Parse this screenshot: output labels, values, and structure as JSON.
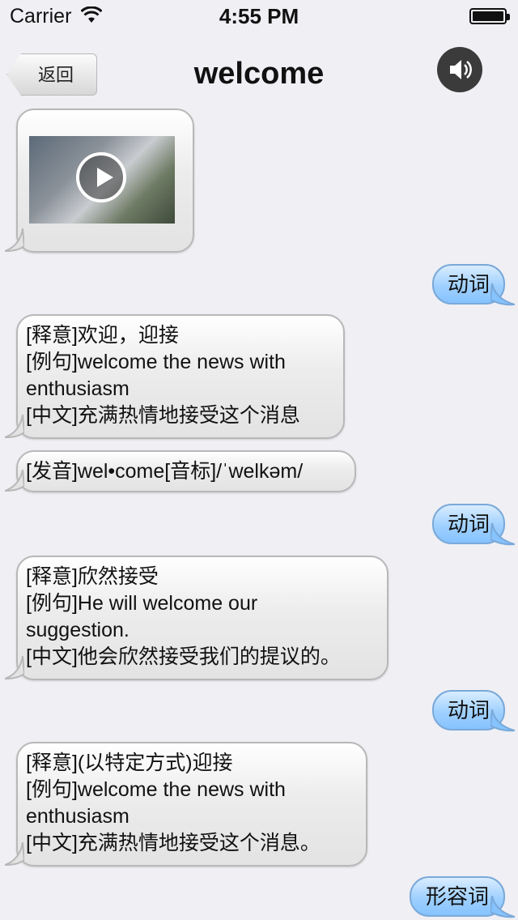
{
  "status_bar": {
    "carrier": "Carrier",
    "time": "4:55 PM"
  },
  "nav": {
    "back_label": "返回",
    "title": "welcome",
    "speaker_icon": "speaker-icon"
  },
  "messages": [
    {
      "type": "video",
      "icon": "play-icon"
    },
    {
      "side": "right",
      "text": "动词"
    },
    {
      "side": "left",
      "lines": [
        "[释意]欢迎，迎接",
        "[例句]welcome the news with",
        "enthusiasm",
        "[中文]充满热情地接受这个消息"
      ]
    },
    {
      "side": "left",
      "lines": [
        "[发音]wel•come[音标]/ˈwelkəm/"
      ]
    },
    {
      "side": "right",
      "text": "动词"
    },
    {
      "side": "left",
      "lines": [
        "[释意]欣然接受",
        "[例句]He will welcome our",
        "suggestion.",
        "[中文]他会欣然接受我们的提议的。"
      ]
    },
    {
      "side": "right",
      "text": "动词"
    },
    {
      "side": "left",
      "lines": [
        "[释意](以特定方式)迎接",
        "[例句]welcome the news with",
        "enthusiasm",
        "[中文]充满热情地接受这个消息。"
      ]
    },
    {
      "side": "right",
      "text": "形容词"
    }
  ]
}
